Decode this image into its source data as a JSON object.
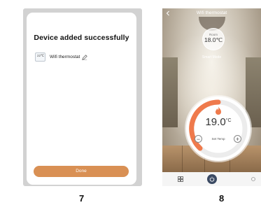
{
  "steps": [
    "7",
    "8"
  ],
  "screen7": {
    "dialog_title": "Device added successfully",
    "device_thumb_text": "22℃",
    "device_name": "Wifi thermostat",
    "done_label": "Done"
  },
  "screen8": {
    "title": "Wifi thermostat",
    "room_label": "Room",
    "room_temp": "18.0℃",
    "mode": "Smart Mode",
    "set_temp_value": "19.0",
    "set_temp_unit": "°C",
    "set_temp_label": "Set Temp",
    "minus_label": "−",
    "plus_label": "+"
  },
  "colors": {
    "accent": "#d99054",
    "arc": "#ef7a4c",
    "power": "#3b4a63"
  },
  "icons": [
    "thermostat-thumbnail-icon",
    "edit-pencil-icon",
    "back-arrow-icon",
    "flame-icon",
    "grid-icon",
    "power-icon"
  ]
}
